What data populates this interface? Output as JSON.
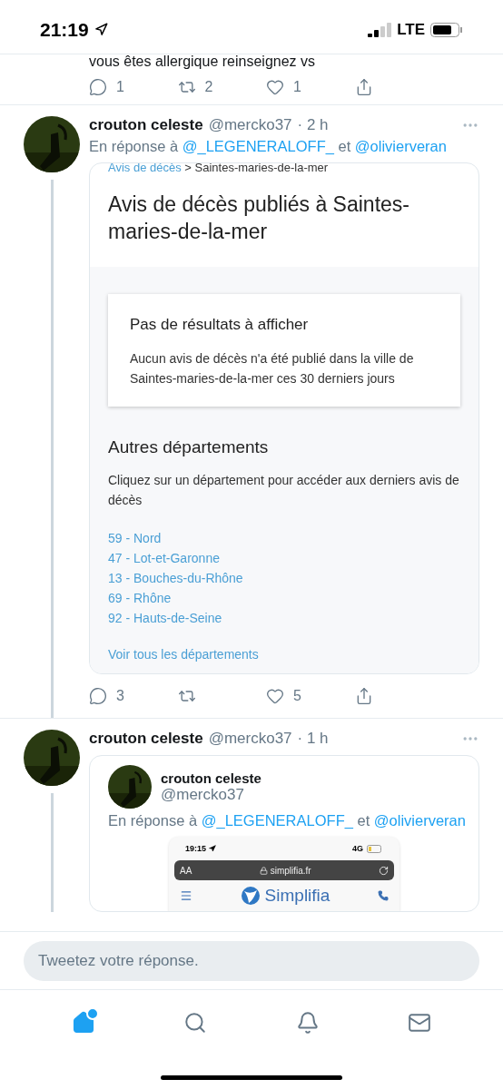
{
  "status_bar": {
    "time": "21:19",
    "network": "LTE"
  },
  "previous_tweet": {
    "text": "vous êtes allergique reinseignez vs",
    "actions": [
      {
        "kind": "reply",
        "count": "1"
      },
      {
        "kind": "retweet",
        "count": "2"
      },
      {
        "kind": "like",
        "count": "1"
      },
      {
        "kind": "share"
      }
    ]
  },
  "tweets": [
    {
      "name": "crouton celeste",
      "handle": "@mercko37",
      "time": "· 2 h",
      "reply_prefix": "En réponse à",
      "mentions": [
        "@_LEGENERALOFF_",
        "@olivierveran"
      ],
      "joiner": "et",
      "thread_line": true,
      "card": {
        "kind": "webpage",
        "breadcrumb_link": "Avis de décès",
        "breadcrumb_rest": "> Saintes-maries-de-la-mer",
        "title": "Avis de décès publiés à Saintes-maries-de-la-mer",
        "notice_title": "Pas de résultats à afficher",
        "notice_text": "Aucun avis de décès n'a été publié dans la ville de Saintes-maries-de-la-mer ces 30 derniers jours",
        "section_title": "Autres départements",
        "section_text": "Cliquez sur un département pour accéder aux derniers avis de décès",
        "links": [
          "59 - Nord",
          "47 - Lot-et-Garonne",
          "13 - Bouches-du-Rhône",
          "69 - Rhône",
          "92 - Hauts-de-Seine"
        ],
        "more_link": "Voir tous les départements"
      },
      "actions": [
        {
          "kind": "reply",
          "count": "3"
        },
        {
          "kind": "retweet"
        },
        {
          "kind": "like",
          "count": "5"
        },
        {
          "kind": "share"
        }
      ]
    },
    {
      "name": "crouton celeste",
      "handle": "@mercko37",
      "time": "· 1 h",
      "thread_line": true,
      "card": {
        "kind": "quoted",
        "name": "crouton celeste",
        "handle": "@mercko37",
        "reply_prefix": "En réponse à",
        "mentions": [
          "@_LEGENERALOFF_",
          "@olivierveran"
        ],
        "joiner": "et",
        "screenshot": {
          "time": "19:15",
          "network": "4G",
          "text_size": "AA",
          "url": "simplifia.fr",
          "brand": "Simplifia"
        }
      }
    }
  ],
  "composer": {
    "placeholder": "Tweetez votre réponse."
  },
  "tab_bar": [
    {
      "kind": "home",
      "selected": true,
      "badge": true
    },
    {
      "kind": "search",
      "selected": false
    },
    {
      "kind": "notifications",
      "selected": false
    },
    {
      "kind": "messages",
      "selected": false
    }
  ]
}
